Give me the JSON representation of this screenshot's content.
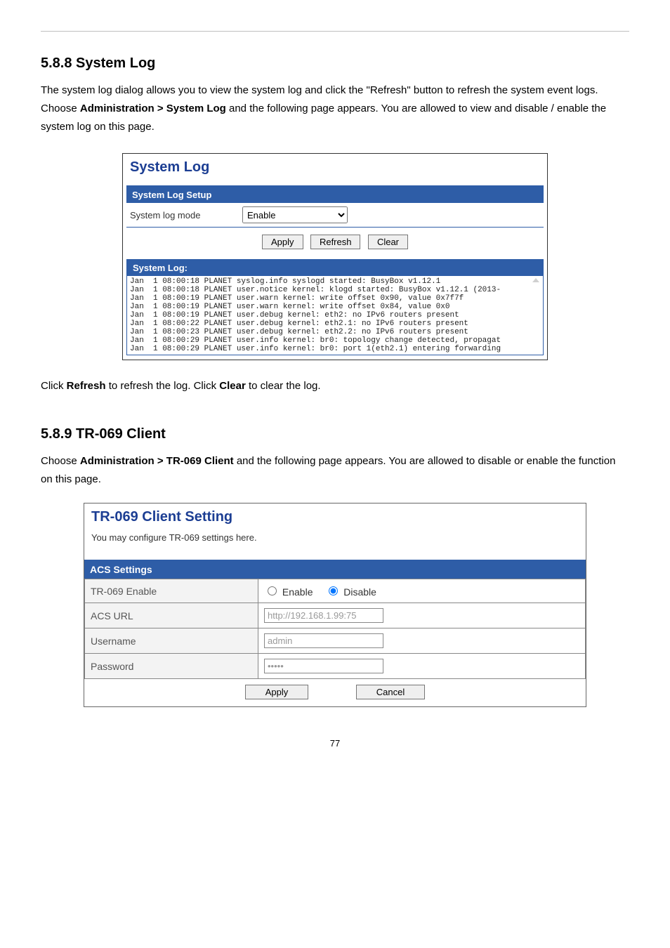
{
  "section1": {
    "heading": "5.8.8 System Log",
    "para_a": "The system log dialog allows you to view the system log and click the \"Refresh\" button to refresh the system event logs. Choose ",
    "para_b": "Administration > System Log",
    "para_c": " and the following page appears. You are allowed to view and disable / enable the system log on this page.",
    "after": {
      "a": "Click ",
      "b": "Refresh",
      "c": " to refresh the log. Click ",
      "d": "Clear",
      "e": " to clear the log."
    }
  },
  "syslog_panel": {
    "title": "System Log",
    "setup_header": "System Log Setup",
    "mode_label": "System log mode",
    "mode_value": "Enable",
    "buttons": {
      "apply": "Apply",
      "refresh": "Refresh",
      "clear": "Clear"
    },
    "log_header": "System Log:",
    "log_lines": "Jan  1 08:00:18 PLANET syslog.info syslogd started: BusyBox v1.12.1\nJan  1 08:00:18 PLANET user.notice kernel: klogd started: BusyBox v1.12.1 (2013-\nJan  1 08:00:19 PLANET user.warn kernel: write offset 0x90, value 0x7f7f\nJan  1 08:00:19 PLANET user.warn kernel: write offset 0x84, value 0x0\nJan  1 08:00:19 PLANET user.debug kernel: eth2: no IPv6 routers present\nJan  1 08:00:22 PLANET user.debug kernel: eth2.1: no IPv6 routers present\nJan  1 08:00:23 PLANET user.debug kernel: eth2.2: no IPv6 routers present\nJan  1 08:00:29 PLANET user.info kernel: br0: topology change detected, propagat\nJan  1 08:00:29 PLANET user.info kernel: br0: port 1(eth2.1) entering forwarding"
  },
  "section2": {
    "heading": "5.8.9 TR-069 Client",
    "para_a": "Choose ",
    "para_b": "Administration > TR-069 Client",
    "para_c": " and the following page appears. You are allowed to disable or enable the function on this page."
  },
  "tr069_panel": {
    "title": "TR-069 Client Setting",
    "sub": "You may configure TR-069 settings here.",
    "header": "ACS Settings",
    "rows": {
      "enable_label": "TR-069 Enable",
      "enable_opt1": "Enable",
      "enable_opt2": "Disable",
      "acs_label": "ACS URL",
      "acs_value": "http://192.168.1.99:75",
      "user_label": "Username",
      "user_value": "admin",
      "pass_label": "Password",
      "pass_value": "•••••"
    },
    "buttons": {
      "apply": "Apply",
      "cancel": "Cancel"
    }
  },
  "page_number": "77"
}
